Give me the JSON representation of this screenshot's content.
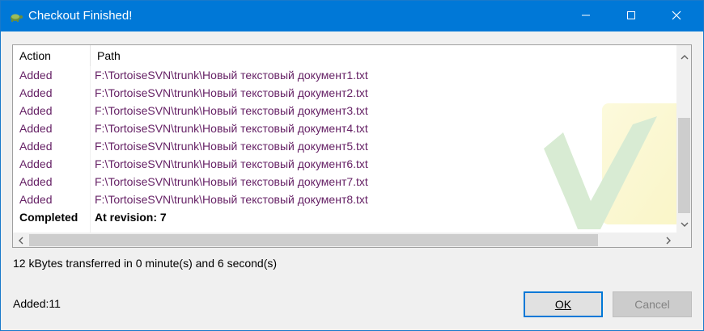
{
  "window": {
    "title": "Checkout Finished!"
  },
  "colors": {
    "titlebar": "#0078d7",
    "added_text": "#662266",
    "focus_border": "#0078d7"
  },
  "icons": {
    "title": "tortoise-icon",
    "minimize": "minimize-icon",
    "maximize": "maximize-icon",
    "close": "close-icon"
  },
  "list": {
    "columns": [
      "Action",
      "Path"
    ],
    "rows": [
      {
        "action": "Added",
        "path": "F:\\TortoiseSVN\\trunk\\Новый текстовый документ1.txt"
      },
      {
        "action": "Added",
        "path": "F:\\TortoiseSVN\\trunk\\Новый текстовый документ2.txt"
      },
      {
        "action": "Added",
        "path": "F:\\TortoiseSVN\\trunk\\Новый текстовый документ3.txt"
      },
      {
        "action": "Added",
        "path": "F:\\TortoiseSVN\\trunk\\Новый текстовый документ4.txt"
      },
      {
        "action": "Added",
        "path": "F:\\TortoiseSVN\\trunk\\Новый текстовый документ5.txt"
      },
      {
        "action": "Added",
        "path": "F:\\TortoiseSVN\\trunk\\Новый текстовый документ6.txt"
      },
      {
        "action": "Added",
        "path": "F:\\TortoiseSVN\\trunk\\Новый текстовый документ7.txt"
      },
      {
        "action": "Added",
        "path": "F:\\TortoiseSVN\\trunk\\Новый текстовый документ8.txt"
      }
    ],
    "completed": {
      "action": "Completed",
      "path": "At revision: 7"
    }
  },
  "status": {
    "transfer": "12 kBytes transferred in 0 minute(s) and 6 second(s)",
    "added": "Added:11"
  },
  "buttons": {
    "ok": "OK",
    "cancel": "Cancel"
  }
}
